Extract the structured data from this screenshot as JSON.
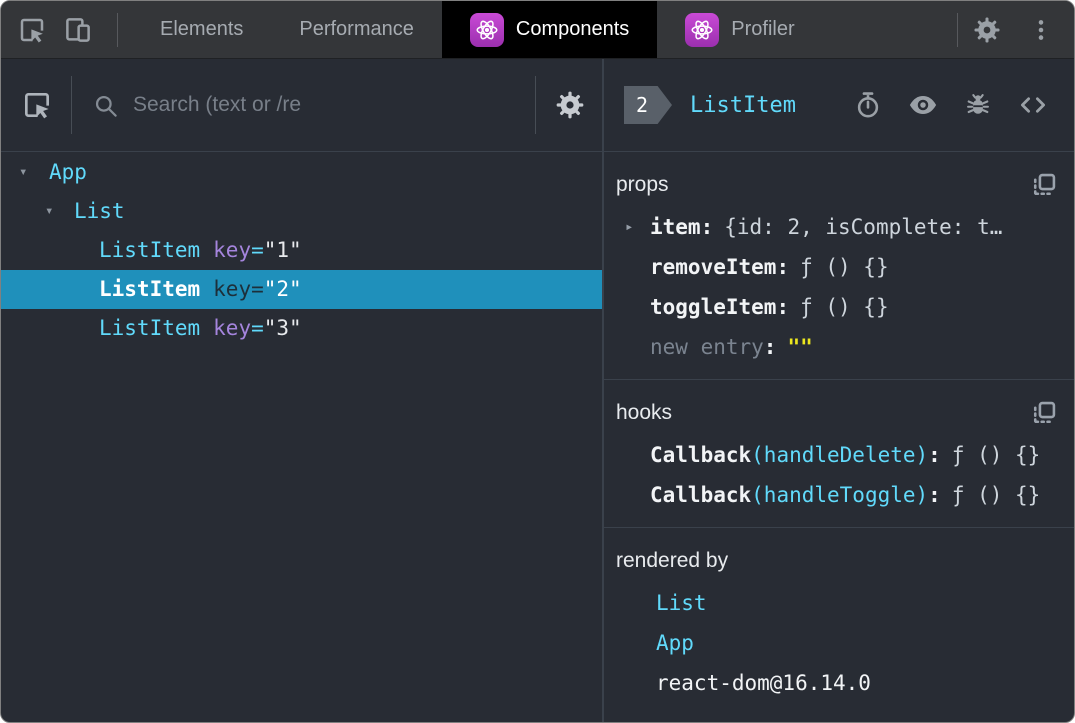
{
  "colors": {
    "accent_cyan": "#61dafb",
    "selection_bg": "#1f90bb",
    "react_icon_purple": "#b93bd0",
    "attr_purple": "#a585dd",
    "editable_yellow": "#ece71f",
    "panel_bg": "#282c34",
    "topbar_bg": "#343639"
  },
  "topbar": {
    "tabs": [
      {
        "label": "Elements"
      },
      {
        "label": "Performance"
      },
      {
        "label": "Components"
      },
      {
        "label": "Profiler"
      }
    ]
  },
  "search": {
    "placeholder": "Search (text or /re"
  },
  "tree": {
    "rows": [
      {
        "arrow": "▾",
        "name": "App"
      },
      {
        "arrow": "▾",
        "name": "List"
      },
      {
        "name": "ListItem",
        "attr": "key",
        "eq": "=",
        "value": "\"1\""
      },
      {
        "name": "ListItem",
        "attr": "key",
        "eq": "=",
        "value": "\"2\""
      },
      {
        "name": "ListItem",
        "attr": "key",
        "eq": "=",
        "value": "\"3\""
      }
    ]
  },
  "inspector": {
    "badge": "2",
    "title": "ListItem",
    "props": {
      "label": "props",
      "rows": [
        {
          "arrow": "▸",
          "key": "item",
          "value": "{id: 2, isComplete: t…"
        },
        {
          "key": "removeItem",
          "value": "ƒ () {}"
        },
        {
          "key": "toggleItem",
          "value": "ƒ () {}"
        },
        {
          "key": "new entry",
          "value": "\"\""
        }
      ]
    },
    "hooks": {
      "label": "hooks",
      "rows": [
        {
          "name": "Callback",
          "arg": "(handleDelete)",
          "value": "ƒ () {}"
        },
        {
          "name": "Callback",
          "arg": "(handleToggle)",
          "value": "ƒ () {}"
        }
      ]
    },
    "rendered_by": {
      "label": "rendered by",
      "items": [
        "List",
        "App",
        "react-dom@16.14.0"
      ]
    }
  },
  "punct": {
    "colon": ":"
  }
}
